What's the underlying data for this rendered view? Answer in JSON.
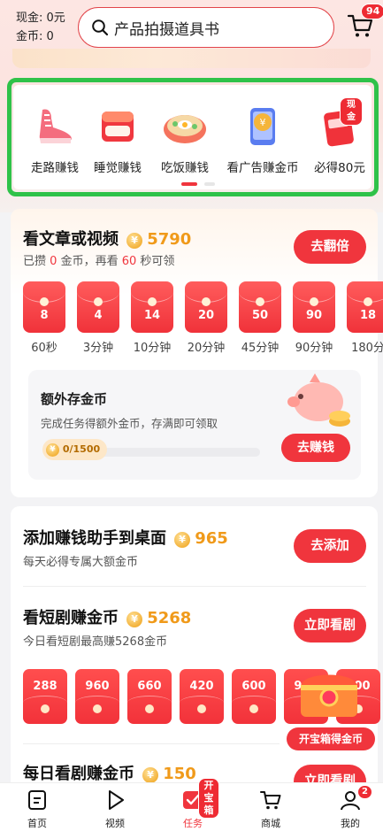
{
  "header": {
    "cash_label": "现金: 0元",
    "gold_label": "金币: 0",
    "search_query": "产品拍摄道具书",
    "cart_badge": "94"
  },
  "categories": [
    {
      "label": "走路赚钱",
      "icon": "sneaker-icon"
    },
    {
      "label": "睡觉赚钱",
      "icon": "pillow-bed-icon"
    },
    {
      "label": "吃饭赚钱",
      "icon": "food-bowl-icon"
    },
    {
      "label": "看广告赚金币",
      "icon": "phone-coin-icon"
    },
    {
      "label": "必得80元",
      "icon": "red-packet-icon",
      "badge": "现金"
    }
  ],
  "watch": {
    "title": "看文章或视频",
    "amount": "5790",
    "sub_prefix": "已攒",
    "sub_saved": "0",
    "sub_mid": "金币，再看",
    "sub_seconds": "60",
    "sub_suffix": "秒可领",
    "button": "去翻倍",
    "envelopes": [
      {
        "value": "8",
        "label": "60秒"
      },
      {
        "value": "4",
        "label": "3分钟"
      },
      {
        "value": "14",
        "label": "10分钟"
      },
      {
        "value": "20",
        "label": "20分钟"
      },
      {
        "value": "50",
        "label": "45分钟"
      },
      {
        "value": "90",
        "label": "90分钟"
      },
      {
        "value": "18",
        "label": "180分"
      }
    ]
  },
  "savings": {
    "title": "额外存金币",
    "desc": "完成任务得额外金币，存满即可领取",
    "progress_text": "0/1500",
    "progress": 0,
    "button": "去赚钱"
  },
  "tasks": [
    {
      "title": "添加赚钱助手到桌面",
      "amount": "965",
      "sub": "每天必得专属大额金币",
      "button": "去添加"
    },
    {
      "title": "看短剧赚金币",
      "amount": "5268",
      "sub": "今日看短剧最高赚5268金币",
      "button": "立即看剧"
    },
    {
      "title": "每日看剧赚金币",
      "amount": "150",
      "button": "立即看剧"
    }
  ],
  "drama_envelopes": [
    "288",
    "960",
    "660",
    "420",
    "600",
    "900",
    "600"
  ],
  "treasure": {
    "label": "开宝箱得金币"
  },
  "nav": {
    "items": [
      {
        "label": "首页"
      },
      {
        "label": "视频"
      },
      {
        "label": "任务"
      },
      {
        "label": "商城"
      },
      {
        "label": "我的"
      }
    ],
    "task_badge": "开宝箱",
    "mine_badge": "2"
  },
  "colors": {
    "accent": "#f0353d",
    "coin": "#f09a1a",
    "highlight": "#2fc249"
  }
}
